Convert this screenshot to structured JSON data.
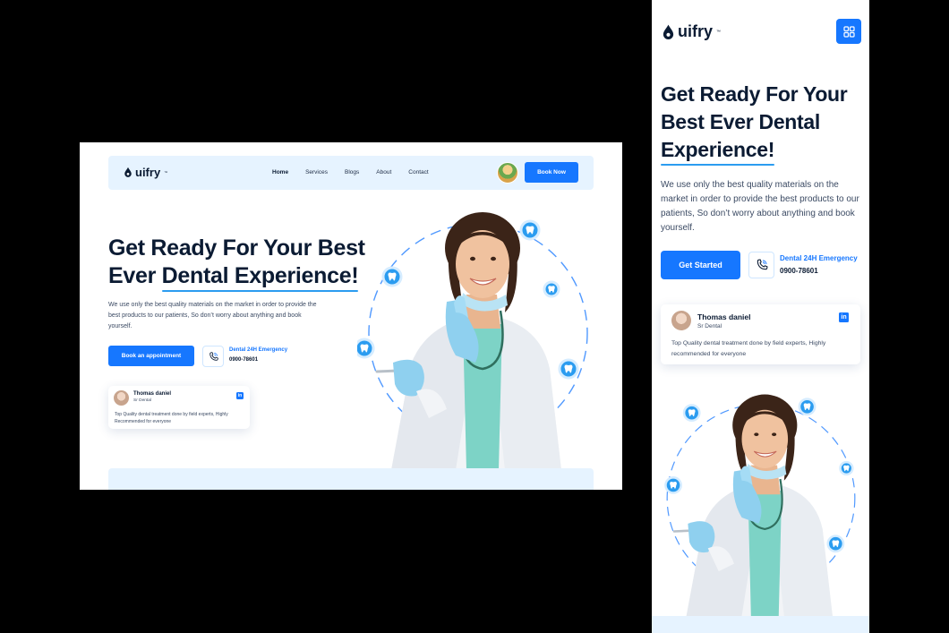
{
  "brand": {
    "name": "uifry",
    "trademark": "™"
  },
  "nav": {
    "items": [
      "Home",
      "Services",
      "Blogs",
      "About",
      "Contact"
    ],
    "active": "Home",
    "book_label": "Book Now"
  },
  "hero": {
    "heading_desktop_line1": "Get Ready For Your Best",
    "heading_desktop_pre": "Ever",
    "heading_mobile_line1": "Get Ready For Your",
    "heading_mobile_line2": "Best Ever Dental",
    "heading_highlight_desktop": "Dental Experience!",
    "heading_highlight_mobile": "Experience!",
    "paragraph": "We use only the best quality materials on the market in order to provide the best products to our patients, So don’t worry about anything and book yourself.",
    "cta_desktop": "Book an appointment",
    "cta_mobile": "Get Started",
    "emergency_label": "Dental 24H Emergency",
    "emergency_phone": "0900-78601"
  },
  "testimonial": {
    "name": "Thomas daniel",
    "role": "Sr Dental",
    "text_desktop": "Top Quality dental treatment done by field experts, Highly Recommended for everyone",
    "text_mobile": "Top Quality dental treatment done by field experts, Highly recommended for everyone",
    "linkedin": "in"
  },
  "colors": {
    "primary": "#1677ff",
    "light": "#e6f3ff",
    "dark": "#0b1b33",
    "accent": "#2b9cf0"
  },
  "icons": [
    "drop-logo-icon",
    "phone-icon",
    "linkedin-icon",
    "tooth-icon",
    "grid-menu-icon"
  ]
}
